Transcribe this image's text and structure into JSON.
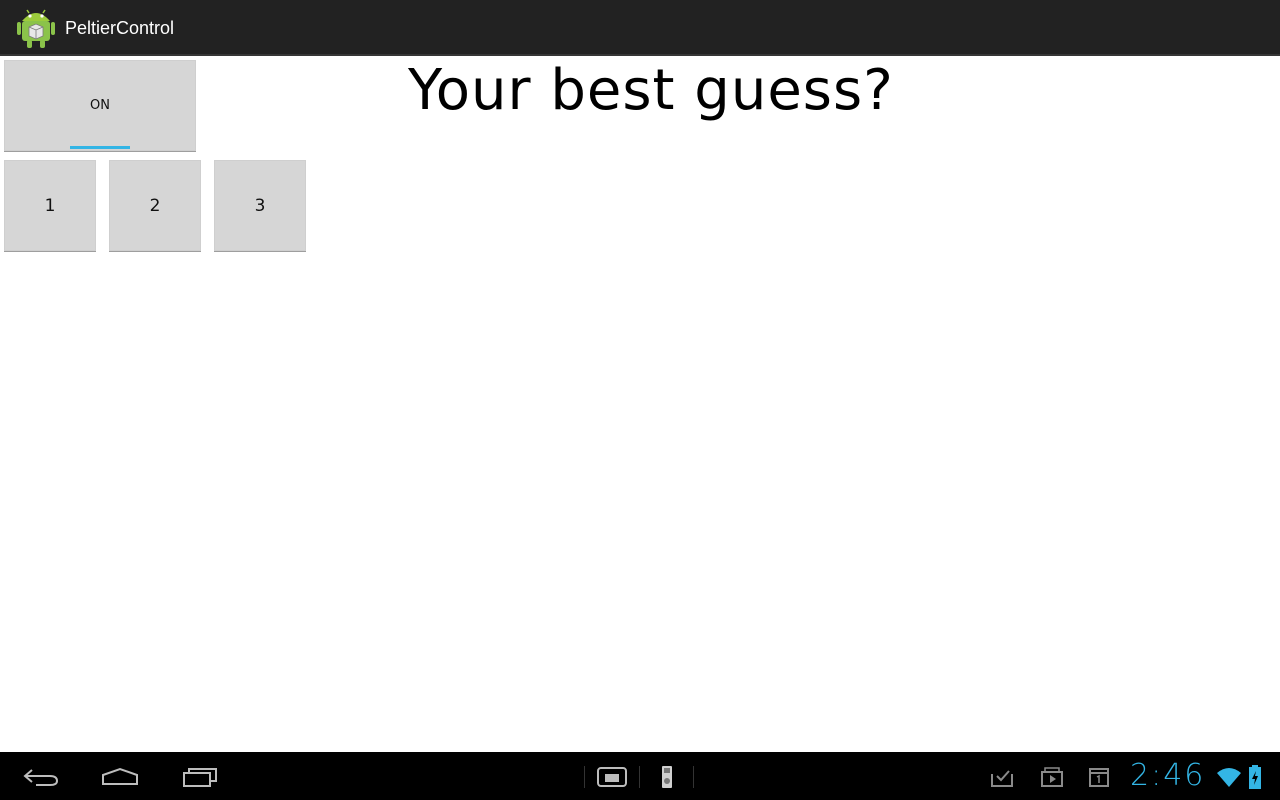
{
  "app": {
    "title": "PeltierControl"
  },
  "main": {
    "question": "Your best guess?",
    "toggle": {
      "label": "ON",
      "state": true
    },
    "number_buttons": [
      "1",
      "2",
      "3"
    ]
  },
  "system_bar": {
    "clock": "2:46",
    "accent_color": "#33b5e5"
  }
}
